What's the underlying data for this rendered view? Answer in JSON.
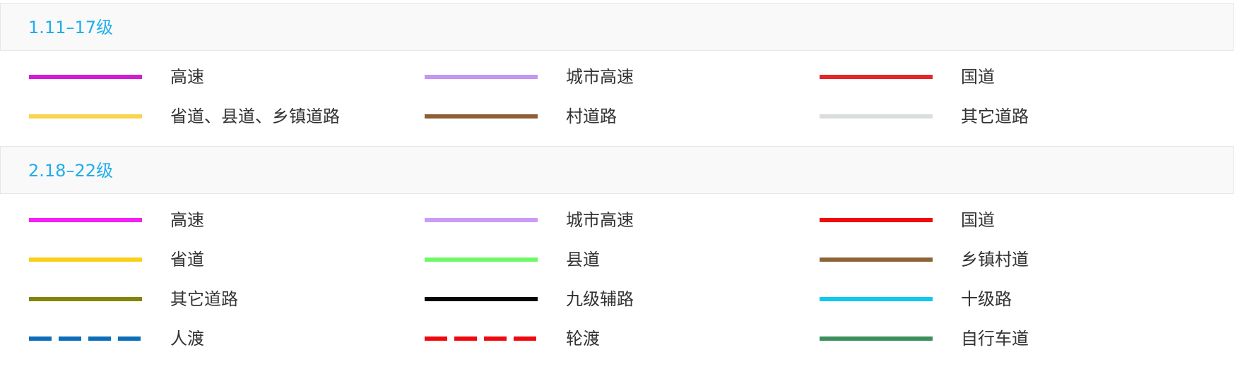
{
  "sections": [
    {
      "title": "1.11–17级",
      "items": [
        {
          "label": "高速",
          "color": "#d21dd6",
          "style": "solid"
        },
        {
          "label": "城市高速",
          "color": "#c496ef",
          "style": "solid"
        },
        {
          "label": "国道",
          "color": "#e4262b",
          "style": "solid"
        },
        {
          "label": "省道、县道、乡镇道路",
          "color": "#fad44e",
          "style": "solid"
        },
        {
          "label": "村道路",
          "color": "#8e5e37",
          "style": "solid"
        },
        {
          "label": "其它道路",
          "color": "#d9dedd",
          "style": "solid"
        }
      ]
    },
    {
      "title": "2.18–22级",
      "items": [
        {
          "label": "高速",
          "color": "#f520f3",
          "style": "solid"
        },
        {
          "label": "城市高速",
          "color": "#cc9bf7",
          "style": "solid"
        },
        {
          "label": "国道",
          "color": "#f10a0c",
          "style": "solid"
        },
        {
          "label": "省道",
          "color": "#fbd01a",
          "style": "solid"
        },
        {
          "label": "县道",
          "color": "#6bf965",
          "style": "solid"
        },
        {
          "label": "乡镇村道",
          "color": "#8e6437",
          "style": "solid"
        },
        {
          "label": "其它道路",
          "color": "#83850a",
          "style": "solid"
        },
        {
          "label": "九级辅路",
          "color": "#060606",
          "style": "solid"
        },
        {
          "label": "十级路",
          "color": "#10c8f2",
          "style": "solid"
        },
        {
          "label": "人渡",
          "color": "#0c6eb8",
          "style": "dashed"
        },
        {
          "label": "轮渡",
          "color": "#f1080e",
          "style": "dashed"
        },
        {
          "label": "自行车道",
          "color": "#3c8f5c",
          "style": "solid"
        }
      ]
    }
  ]
}
